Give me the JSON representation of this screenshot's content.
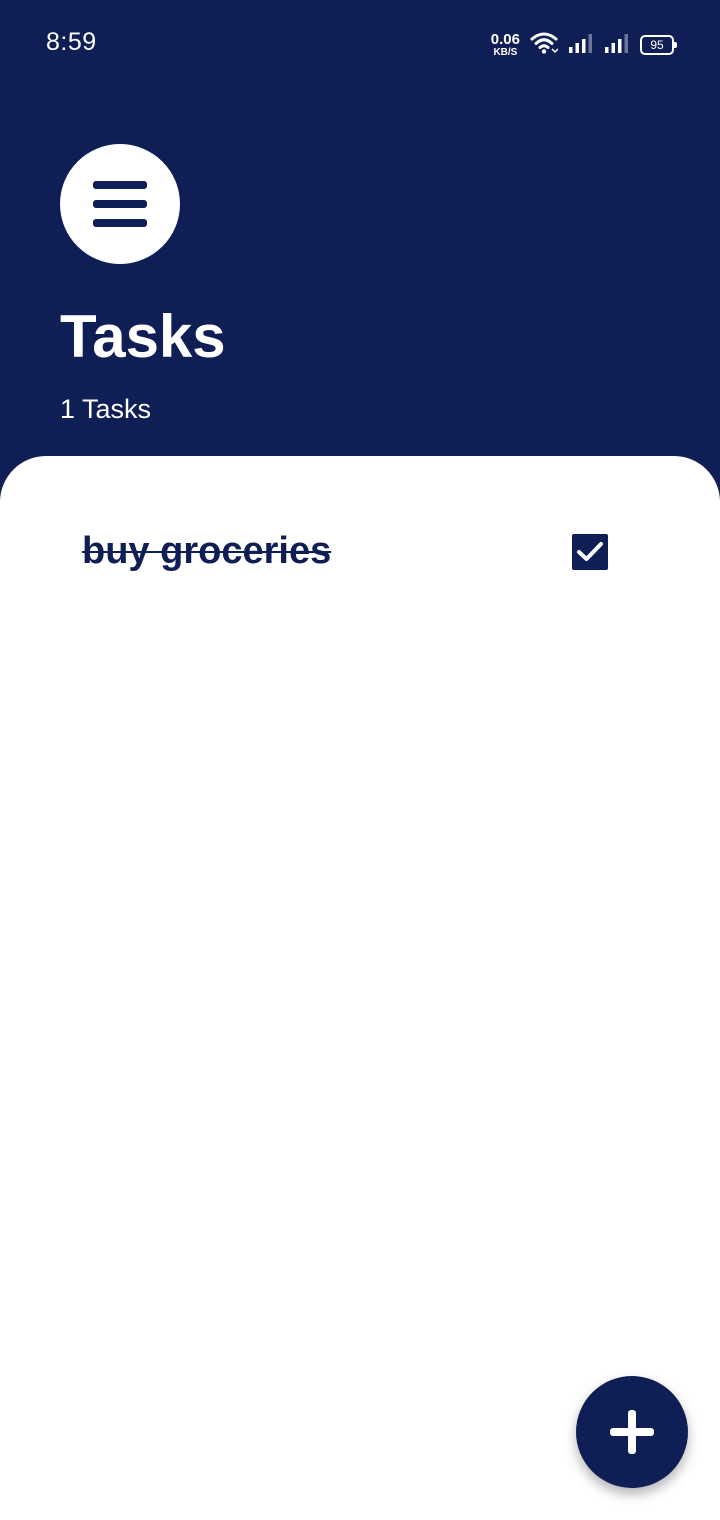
{
  "status_bar": {
    "time": "8:59",
    "net_speed_value": "0.06",
    "net_speed_unit": "KB/S",
    "battery_level": "95",
    "icons": [
      "wifi-icon",
      "signal-icon",
      "signal-icon",
      "battery-icon"
    ]
  },
  "header": {
    "menu_icon": "menu-icon",
    "title": "Tasks",
    "task_count": "1 Tasks"
  },
  "tasks": [
    {
      "label": "buy groceries",
      "completed": true
    }
  ],
  "fab": {
    "icon": "plus-icon"
  },
  "colors": {
    "primary": "#0f1f55",
    "surface": "#ffffff"
  }
}
